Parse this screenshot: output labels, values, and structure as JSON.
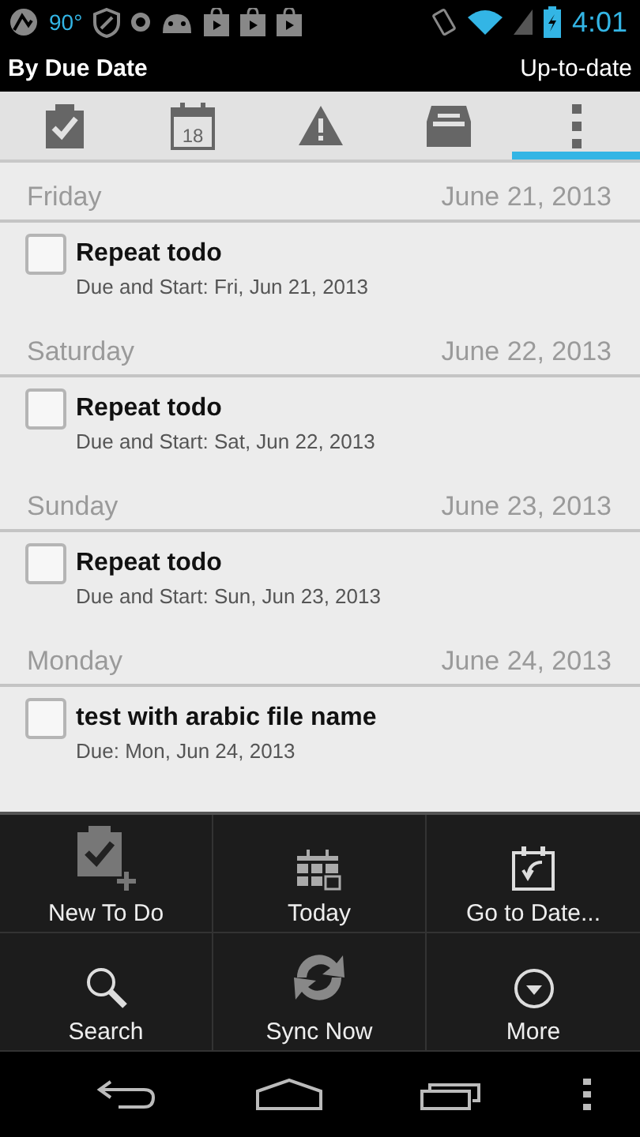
{
  "status_bar": {
    "temperature": "90°",
    "time": "4:01"
  },
  "title_bar": {
    "title": "By Due Date",
    "status": "Up-to-date"
  },
  "tabs": [
    {
      "kind": "todo",
      "selected": false
    },
    {
      "kind": "calendar",
      "icon_text": "18",
      "selected": false
    },
    {
      "kind": "warning",
      "selected": false
    },
    {
      "kind": "inbox",
      "selected": false
    },
    {
      "kind": "overflow",
      "selected": true
    }
  ],
  "groups": [
    {
      "day": "Friday",
      "date": "June 21, 2013",
      "tasks": [
        {
          "title": "Repeat todo",
          "detail": "Due and Start: Fri, Jun 21, 2013",
          "checked": false
        }
      ]
    },
    {
      "day": "Saturday",
      "date": "June 22, 2013",
      "tasks": [
        {
          "title": "Repeat todo",
          "detail": "Due and Start: Sat, Jun 22, 2013",
          "checked": false
        }
      ]
    },
    {
      "day": "Sunday",
      "date": "June 23, 2013",
      "tasks": [
        {
          "title": "Repeat todo",
          "detail": "Due and Start: Sun, Jun 23, 2013",
          "checked": false
        }
      ]
    },
    {
      "day": "Monday",
      "date": "June 24, 2013",
      "tasks": [
        {
          "title": "test with arabic file name",
          "detail": "Due: Mon, Jun 24, 2013",
          "checked": false
        }
      ]
    }
  ],
  "menu": [
    {
      "kind": "new",
      "label": "New To Do"
    },
    {
      "kind": "today",
      "label": "Today"
    },
    {
      "kind": "goto",
      "label": "Go to Date..."
    },
    {
      "kind": "search",
      "label": "Search"
    },
    {
      "kind": "sync",
      "label": "Sync Now"
    },
    {
      "kind": "more",
      "label": "More"
    }
  ]
}
